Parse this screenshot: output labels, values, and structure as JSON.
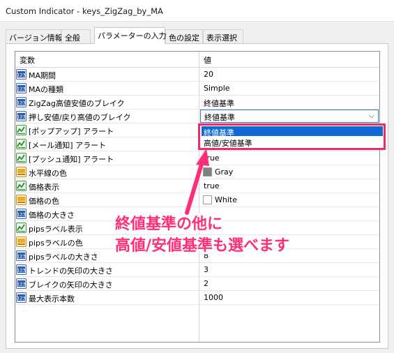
{
  "window": {
    "title": "Custom Indicator - keys_ZigZag_by_MA"
  },
  "tabs": [
    {
      "label": "バージョン情報"
    },
    {
      "label": "全般"
    },
    {
      "label": "パラメーターの入力"
    },
    {
      "label": "色の設定"
    },
    {
      "label": "表示選択"
    }
  ],
  "grid": {
    "header": {
      "name": "変数",
      "value": "値"
    },
    "rows": [
      {
        "icon": "number-param-icon",
        "name": "MA期間",
        "value": "20"
      },
      {
        "icon": "number-param-icon",
        "name": "MAの種類",
        "value": "Simple"
      },
      {
        "icon": "number-param-icon",
        "name": "ZigZag高値安値のブレイク",
        "value": "終値基準"
      },
      {
        "icon": "number-param-icon",
        "name": "押し安値/戻り高値のブレイク",
        "value": "終値基準"
      },
      {
        "icon": "bool-param-icon",
        "name": "[ポップアップ] アラート",
        "value": ""
      },
      {
        "icon": "bool-param-icon",
        "name": "[メール通知] アラート",
        "value": ""
      },
      {
        "icon": "bool-param-icon",
        "name": "[プッシュ通知] アラート",
        "value": "true"
      },
      {
        "icon": "color-param-icon",
        "name": "水平線の色",
        "value": "Gray",
        "swatch": "#7f7f7f"
      },
      {
        "icon": "bool-param-icon",
        "name": "価格表示",
        "value": "true"
      },
      {
        "icon": "color-param-icon",
        "name": "価格の色",
        "value": "White",
        "swatch": "#ffffff"
      },
      {
        "icon": "number-param-icon",
        "name": "価格の大きさ",
        "value": ""
      },
      {
        "icon": "bool-param-icon",
        "name": "pipsラベル表示",
        "value": "true"
      },
      {
        "icon": "color-param-icon",
        "name": "pipsラベルの色",
        "value": ""
      },
      {
        "icon": "number-param-icon",
        "name": "pipsラベルの大きさ",
        "value": "8"
      },
      {
        "icon": "number-param-icon",
        "name": "トレンドの矢印の大きさ",
        "value": "3"
      },
      {
        "icon": "number-param-icon",
        "name": "ブレイクの矢印の大きさ",
        "value": "2"
      },
      {
        "icon": "number-param-icon",
        "name": "最大表示本数",
        "value": "1000"
      }
    ]
  },
  "dropdown": {
    "options": [
      {
        "label": "終値基準",
        "selected": true
      },
      {
        "label": "高値/安値基準",
        "selected": false
      }
    ]
  },
  "annotation": {
    "line1": "終値基準の他に",
    "line2": "高値/安値基準も選べます",
    "color": "#ff2e7a"
  },
  "colors": {
    "highlight_border": "#ec2c64",
    "selection_blue": "#0f6ad6"
  }
}
